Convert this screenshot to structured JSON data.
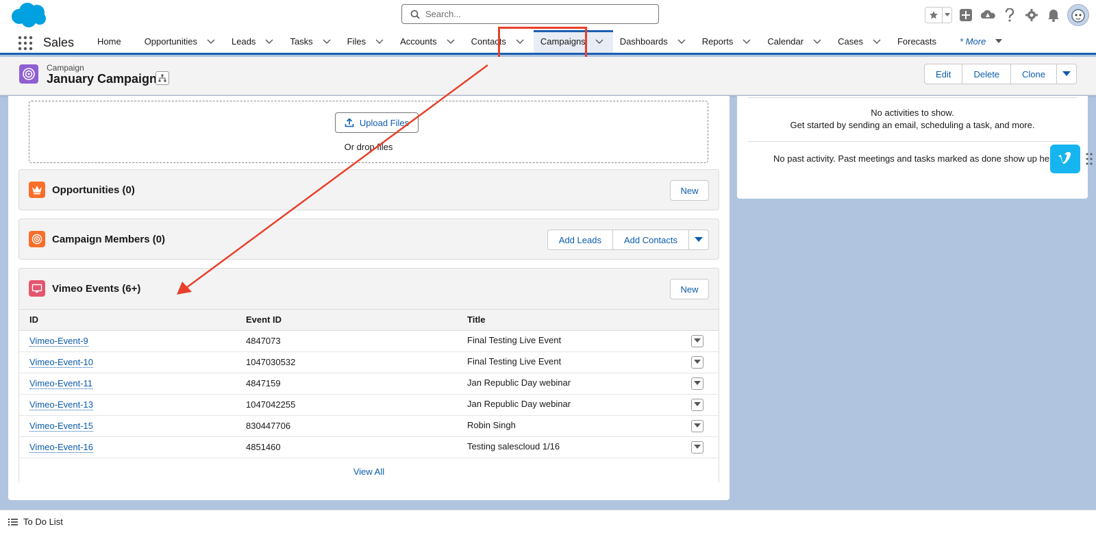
{
  "header": {
    "search_placeholder": "Search..."
  },
  "nav": {
    "app_name": "Sales",
    "items": [
      {
        "label": "Home",
        "caret": false
      },
      {
        "label": "Opportunities",
        "caret": true
      },
      {
        "label": "Leads",
        "caret": true
      },
      {
        "label": "Tasks",
        "caret": true
      },
      {
        "label": "Files",
        "caret": true
      },
      {
        "label": "Accounts",
        "caret": true
      },
      {
        "label": "Contacts",
        "caret": true
      },
      {
        "label": "Campaigns",
        "caret": true,
        "active": true
      },
      {
        "label": "Dashboards",
        "caret": true
      },
      {
        "label": "Reports",
        "caret": true
      },
      {
        "label": "Calendar",
        "caret": true
      },
      {
        "label": "Cases",
        "caret": true
      },
      {
        "label": "Forecasts",
        "caret": false
      }
    ],
    "more_label": "* More"
  },
  "record": {
    "type_label": "Campaign",
    "title": "January Campaign",
    "actions": [
      "Edit",
      "Delete",
      "Clone"
    ]
  },
  "files": {
    "upload_label": "Upload Files",
    "drop_text": "Or drop files"
  },
  "opportunities": {
    "title": "Opportunities (0)",
    "new_label": "New"
  },
  "campaign_members": {
    "title": "Campaign Members (0)",
    "add_leads_label": "Add Leads",
    "add_contacts_label": "Add Contacts"
  },
  "vimeo_events": {
    "title": "Vimeo Events (6+)",
    "new_label": "New",
    "columns": [
      "ID",
      "Event ID",
      "Title"
    ],
    "rows": [
      {
        "id": "Vimeo-Event-9",
        "event_id": "4847073",
        "title": "Final Testing Live Event"
      },
      {
        "id": "Vimeo-Event-10",
        "event_id": "1047030532",
        "title": "Final Testing Live Event"
      },
      {
        "id": "Vimeo-Event-11",
        "event_id": "4847159",
        "title": "Jan Republic Day webinar"
      },
      {
        "id": "Vimeo-Event-13",
        "event_id": "1047042255",
        "title": "Jan Republic Day webinar"
      },
      {
        "id": "Vimeo-Event-15",
        "event_id": "830447706",
        "title": "Robin Singh"
      },
      {
        "id": "Vimeo-Event-16",
        "event_id": "4851460",
        "title": "Testing salescloud 1/16"
      }
    ],
    "view_all_label": "View All"
  },
  "activity": {
    "no_activities": "No activities to show.",
    "get_started": "Get started by sending an email, scheduling a task, and more.",
    "no_past": "No past activity. Past meetings and tasks marked as done show up here."
  },
  "footer": {
    "todo_label": "To Do List"
  },
  "colors": {
    "brand_blue": "#0b5cab",
    "nav_accent": "#1b5eb0",
    "annotation_red": "#e8402a",
    "campaign_purple": "#8f5fd4",
    "vimeo_blue": "#17b5f0",
    "background": "#b0c4df"
  },
  "icons": [
    "salesforce-cloud-logo",
    "search-icon",
    "star-icon",
    "add-icon",
    "trailhead-icon",
    "help-icon",
    "gear-icon",
    "bell-icon",
    "avatar",
    "app-launcher-icon",
    "pencil-icon",
    "campaign-icon",
    "hierarchy-icon",
    "upload-icon",
    "crown-icon",
    "target-icon",
    "monitor-icon",
    "vimeo-icon",
    "todo-list-icon"
  ]
}
